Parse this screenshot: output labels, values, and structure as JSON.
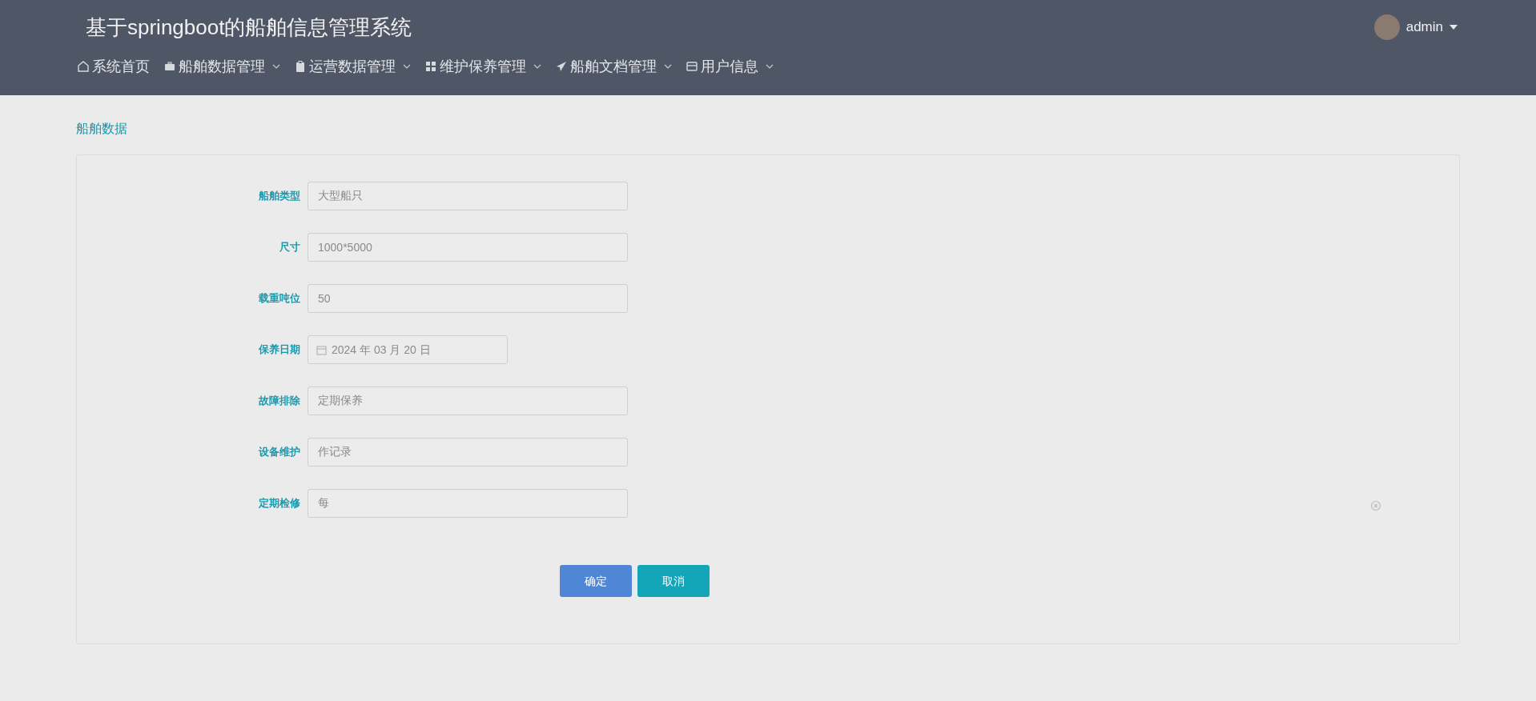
{
  "header": {
    "title": "基于springboot的船舶信息管理系统",
    "user": {
      "name": "admin"
    }
  },
  "nav": [
    {
      "label": "系统首页",
      "dropdown": false
    },
    {
      "label": "船舶数据管理",
      "dropdown": true
    },
    {
      "label": "运营数据管理",
      "dropdown": true
    },
    {
      "label": "维护保养管理",
      "dropdown": true
    },
    {
      "label": "船舶文档管理",
      "dropdown": true
    },
    {
      "label": "用户信息",
      "dropdown": true
    }
  ],
  "section_title": "船舶数据",
  "form": {
    "fields": [
      {
        "kind": "text",
        "label": "船舶类型",
        "value": "大型船只"
      },
      {
        "kind": "text",
        "label": "尺寸",
        "value": "1000*5000"
      },
      {
        "kind": "text",
        "label": "载重吨位",
        "value": "50"
      },
      {
        "kind": "date",
        "label": "保养日期",
        "value": "2024 年 03 月 20 日"
      },
      {
        "kind": "text",
        "label": "故障排除",
        "value": "定期保养"
      },
      {
        "kind": "text",
        "label": "设备维护",
        "value": "作记录"
      },
      {
        "kind": "text",
        "label": "定期检修",
        "value": "每"
      }
    ],
    "buttons": [
      {
        "kind": "primary",
        "label": "确定"
      },
      {
        "kind": "secondary",
        "label": "取消"
      }
    ]
  }
}
